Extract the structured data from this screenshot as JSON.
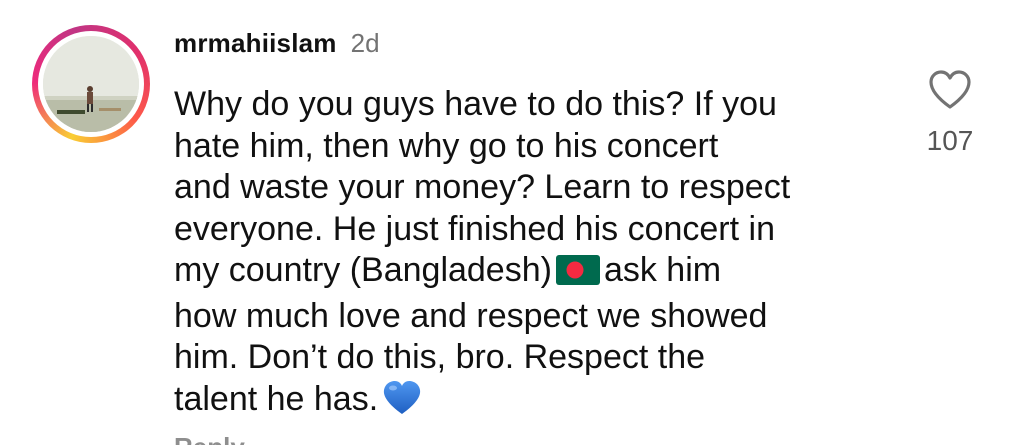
{
  "comment": {
    "username": "mrmahiislam",
    "time_ago": "2d",
    "lines": [
      "Why do you guys have to do this? If you",
      "hate him, then why go to his concert",
      "and waste your money? Learn to respect",
      "everyone. He just finished his concert in",
      "my country (Bangladesh)",
      "ask him",
      "how much love and respect we showed",
      "him. Don’t do this, bro. Respect the",
      "talent he has."
    ],
    "like_count": "107",
    "reply_label": "Reply"
  },
  "icons": {
    "like": "heart-outline-icon",
    "flag": "bangladesh-flag-emoji",
    "heart": "blue-heart-emoji"
  },
  "colors": {
    "story_ring": [
      "#f9ce34",
      "#ee2a7b",
      "#c13584"
    ],
    "timestamp": "#737373",
    "flag_green": "#006a4e",
    "flag_red": "#f42a41",
    "heart_blue": "#1f6fd6"
  }
}
